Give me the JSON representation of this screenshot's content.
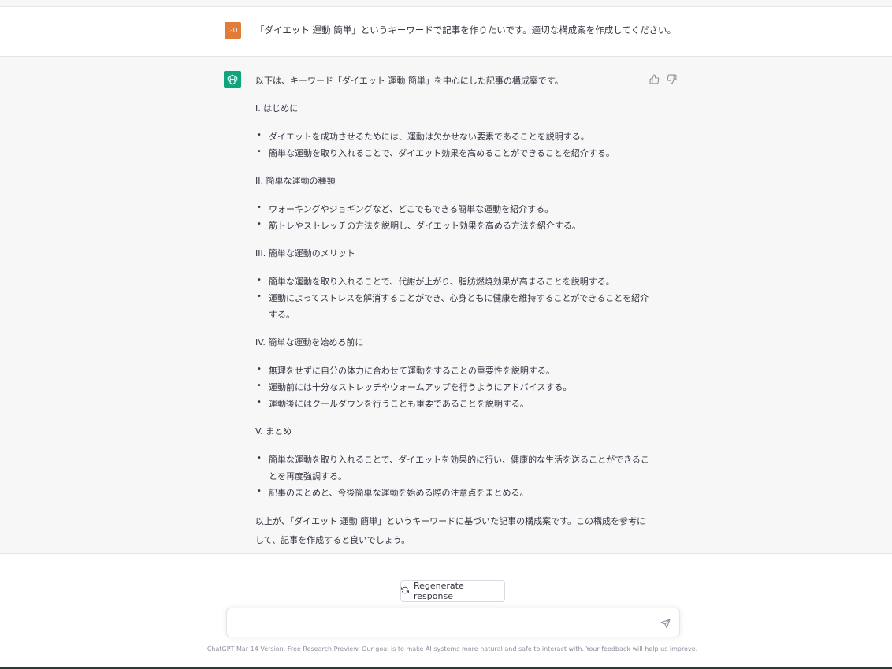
{
  "user_message": {
    "avatar_initials": "GU",
    "text": "「ダイエット 運動 簡単」というキーワードで記事を作りたいです。適切な構成案を作成してください。"
  },
  "assistant_message": {
    "intro": "以下は、キーワード「ダイエット 運動 簡単」を中心にした記事の構成案です。",
    "sections": [
      {
        "heading": "I. はじめに",
        "bullets": [
          "ダイエットを成功させるためには、運動は欠かせない要素であることを説明する。",
          "簡単な運動を取り入れることで、ダイエット効果を高めることができることを紹介する。"
        ]
      },
      {
        "heading": "II. 簡単な運動の種類",
        "bullets": [
          "ウォーキングやジョギングなど、どこでもできる簡単な運動を紹介する。",
          "筋トレやストレッチの方法を説明し、ダイエット効果を高める方法を紹介する。"
        ]
      },
      {
        "heading": "III. 簡単な運動のメリット",
        "bullets": [
          "簡単な運動を取り入れることで、代謝が上がり、脂肪燃焼効果が高まることを説明する。",
          "運動によってストレスを解消することができ、心身ともに健康を維持することができることを紹介する。"
        ]
      },
      {
        "heading": "IV. 簡単な運動を始める前に",
        "bullets": [
          "無理をせずに自分の体力に合わせて運動をすることの重要性を説明する。",
          "運動前には十分なストレッチやウォームアップを行うようにアドバイスする。",
          "運動後にはクールダウンを行うことも重要であることを説明する。"
        ]
      },
      {
        "heading": "V. まとめ",
        "bullets": [
          "簡単な運動を取り入れることで、ダイエットを効果的に行い、健康的な生活を送ることができることを再度強調する。",
          "記事のまとめと、今後簡単な運動を始める際の注意点をまとめる。"
        ]
      }
    ],
    "outro": "以上が、「ダイエット 運動 簡単」というキーワードに基づいた記事の構成案です。この構成を参考にして、記事を作成すると良いでしょう。"
  },
  "regenerate_label": "Regenerate response",
  "input": {
    "value": "",
    "placeholder": ""
  },
  "footer": {
    "link_text": "ChatGPT Mar 14 Version",
    "text": ". Free Research Preview. Our goal is to make AI systems more natural and safe to interact with. Your feedback will help us improve."
  },
  "colors": {
    "user_avatar": "#e07b39",
    "gpt_avatar": "#10a37f",
    "assistant_bg": "#f7f7f8"
  },
  "icons": [
    "openai-logo-icon",
    "thumbs-up-icon",
    "thumbs-down-icon",
    "refresh-icon",
    "send-icon"
  ]
}
